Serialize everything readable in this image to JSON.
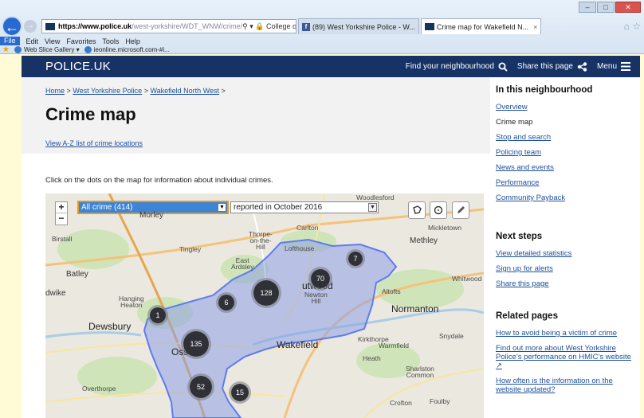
{
  "browser": {
    "url_host": "https://www.police.uk",
    "url_path": "/west-yorkshire/WDT_WNW/crime/",
    "address_tools": "⚲ ▾ 🔒 College of Policing Limite... ↻",
    "tabs": [
      {
        "label": "(89) West Yorkshire Police - W..."
      },
      {
        "label": "Crime map for Wakefield N..."
      }
    ],
    "tab_close": "×",
    "menu": [
      "File",
      "Edit",
      "View",
      "Favorites",
      "Tools",
      "Help"
    ],
    "favorites": [
      "Web Slice Gallery ▾",
      "ieonline.microsoft.com-#i..."
    ]
  },
  "header": {
    "logo": "POLICE.UK",
    "find": "Find your neighbourhood",
    "share": "Share this page",
    "menu": "Menu"
  },
  "breadcrumb": {
    "home": "Home",
    "force": "West Yorkshire Police",
    "area": "Wakefield North West",
    "sep": ">"
  },
  "page": {
    "title": "Crime map",
    "az_link": "View A-Z list of crime locations",
    "intro": "Click on the dots on the map for information about individual crimes."
  },
  "map": {
    "crime_select": "All crime (414)",
    "period_select": "reported in October 2016",
    "zoom_in": "+",
    "zoom_out": "−",
    "places": {
      "woodlesford": "Woodlesford",
      "morley": "Morley",
      "carlton": "Carlton",
      "micklet": "Mickletown",
      "birstall": "Birstall",
      "thorpe": "Thorpe-\non-the-\nHill",
      "lofthouse": "Lofthouse",
      "methley": "Methley",
      "tingley": "Tingley",
      "east_ardsley": "East\nArdsley",
      "batley": "Batley",
      "outwood": "utwood",
      "whitwood": "Whitwood",
      "dwike": "dwike",
      "newton_hill": "Newton\nHill",
      "altofts": "Altofts",
      "hanging_heaton": "Hanging\nHeaton",
      "normanton": "Normanton",
      "dewsbury": "Dewsbury",
      "wakefield": "Wakefield",
      "snydale": "Snydale",
      "kirkthorpe": "Kirkthorpe",
      "warmfield": "Warmfield",
      "ossett": "Osse",
      "heath": "Heath",
      "sharlston": "Sharlston\nCommon",
      "overthorpe": "Overthorpe",
      "crofton": "Crofton",
      "foulby": "Foulby"
    },
    "clusters": [
      {
        "count": "7"
      },
      {
        "count": "70"
      },
      {
        "count": "128"
      },
      {
        "count": "6"
      },
      {
        "count": "1"
      },
      {
        "count": "135"
      },
      {
        "count": "52"
      },
      {
        "count": "15"
      }
    ],
    "colors": {
      "boundary": "#5f7bf0",
      "fill": "#8ea1e6"
    }
  },
  "sidebar": {
    "neighbourhood": {
      "heading": "In this neighbourhood",
      "items": [
        "Overview",
        "Crime map",
        "Stop and search",
        "Policing team",
        "News and events",
        "Performance",
        "Community Payback"
      ]
    },
    "next": {
      "heading": "Next steps",
      "items": [
        "View detailed statistics",
        "Sign up for alerts",
        "Share this page"
      ]
    },
    "related": {
      "heading": "Related pages",
      "items": [
        "How to avoid being a victim of crime",
        "Find out more about West Yorkshire Police's performance on HMIC's website ↗",
        "How often is the information on the website updated?"
      ]
    }
  }
}
